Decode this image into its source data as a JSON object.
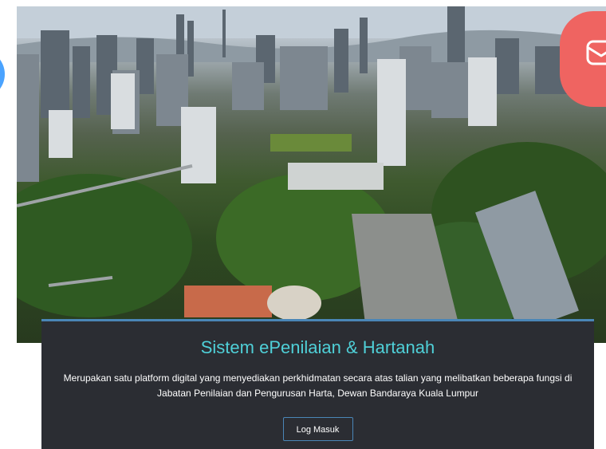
{
  "hero": {
    "image_alt": "Kuala Lumpur city skyline aerial view"
  },
  "card": {
    "title": "Sistem ePenilaian & Hartanah",
    "description": "Merupakan satu platform digital yang menyediakan perkhidmatan secara atas talian yang melibatkan beberapa fungsi di Jabatan Penilaian dan Pengurusan Harta, Dewan Bandaraya Kuala Lumpur",
    "login_label": "Log Masuk"
  },
  "colors": {
    "title": "#4fd0d8",
    "card_bg": "#2b2d33",
    "accent_border": "#4a86b7",
    "fab": "#ef6461",
    "left_circle": "#4aa3ff"
  },
  "icons": {
    "fab_icon": "mail-open-icon"
  }
}
